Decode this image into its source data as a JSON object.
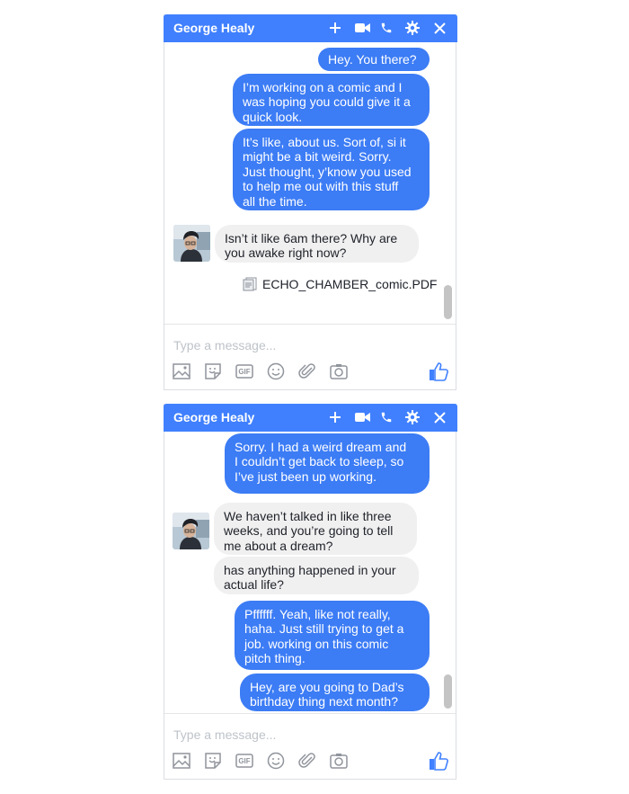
{
  "colors": {
    "accent": "#4080ff",
    "outgoing": "#3c7cf5",
    "incoming": "#f1f0f0",
    "icon": "#90949c"
  },
  "icons": {
    "header": [
      "plus-icon",
      "video-camera-icon",
      "phone-icon",
      "gear-icon",
      "close-icon"
    ],
    "toolbar": [
      "image-icon",
      "sticker-icon",
      "gif-icon",
      "emoji-icon",
      "paperclip-icon",
      "camera-icon"
    ],
    "send": "thumbs-up-icon"
  },
  "chat1": {
    "title": "George Healy",
    "messages": [
      "Hey. You there?",
      [
        "I’m working on a comic and I",
        "was hoping you could give it a",
        "quick look."
      ],
      [
        "It’s like, about us. Sort of, si it",
        "might be a bit weird. Sorry.",
        "Just thought, y’know you used",
        "to help me out with this stuff",
        "all the time."
      ],
      [
        "Isn’t it like 6am there? Why are",
        "you awake right now?"
      ]
    ],
    "attachment": "ECHO_CHAMBER_comic.PDF",
    "placeholder": "Type a message...",
    "gif_label": "GIF"
  },
  "chat2": {
    "title": "George Healy",
    "messages": [
      [
        "Sorry. I had a weird dream and",
        "I couldn’t get back to sleep, so",
        "I’ve just been up working."
      ],
      [
        "We haven’t talked in like three",
        "weeks, and you’re going to tell",
        "me about a dream?"
      ],
      [
        "has anything happened in your",
        "actual life?"
      ],
      [
        "Pffffff. Yeah, like not really,",
        "haha. Just still trying to get a",
        "job. working on this comic",
        "pitch thing."
      ],
      [
        "Hey, are you going to Dad’s",
        "birthday thing next month?"
      ]
    ],
    "placeholder": "Type a message...",
    "gif_label": "GIF"
  }
}
